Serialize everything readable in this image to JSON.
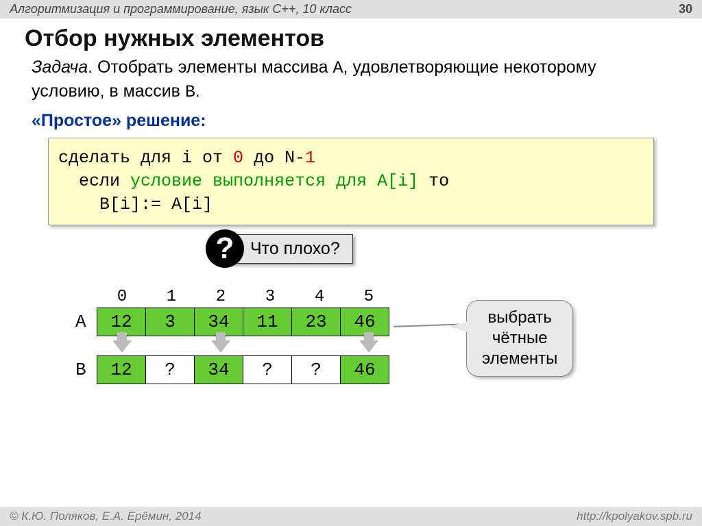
{
  "header": {
    "course": "Алгоритмизация и программирование, язык C++, 10 класс",
    "page": "30"
  },
  "title": "Отбор нужных элементов",
  "task": {
    "label": "Задача",
    "text_before_A": ". Отобрать элементы массива ",
    "A": "A",
    "text_mid": ", удовлетворяющие некоторому условию, в массив ",
    "B": "B",
    "text_end": "."
  },
  "solution_label": "«Простое» решение:",
  "code": {
    "l1_a": "сделать для i от ",
    "l1_zero": "0",
    "l1_b": " до N-",
    "l1_one": "1",
    "l2_a": "  если ",
    "l2_cond": "условие выполняется для A[i]",
    "l2_b": " то",
    "l3": "    B[i]:= A[i]"
  },
  "question": {
    "mark": "?",
    "text": "Что плохо?"
  },
  "arrays": {
    "indices": [
      "0",
      "1",
      "2",
      "3",
      "4",
      "5"
    ],
    "A_label": "A",
    "A_values": [
      "12",
      "3",
      "34",
      "11",
      "23",
      "46"
    ],
    "B_label": "B",
    "B_values": [
      "12",
      "?",
      "34",
      "?",
      "?",
      "46"
    ],
    "B_green": [
      true,
      false,
      true,
      false,
      false,
      true
    ],
    "arrows_at": [
      true,
      false,
      true,
      false,
      false,
      true
    ]
  },
  "callout": {
    "l1": "выбрать",
    "l2": "чётные",
    "l3": "элементы"
  },
  "footer": {
    "left": "© К.Ю. Поляков, Е.А. Ерёмин, 2014",
    "right": "http://kpolyakov.spb.ru"
  }
}
